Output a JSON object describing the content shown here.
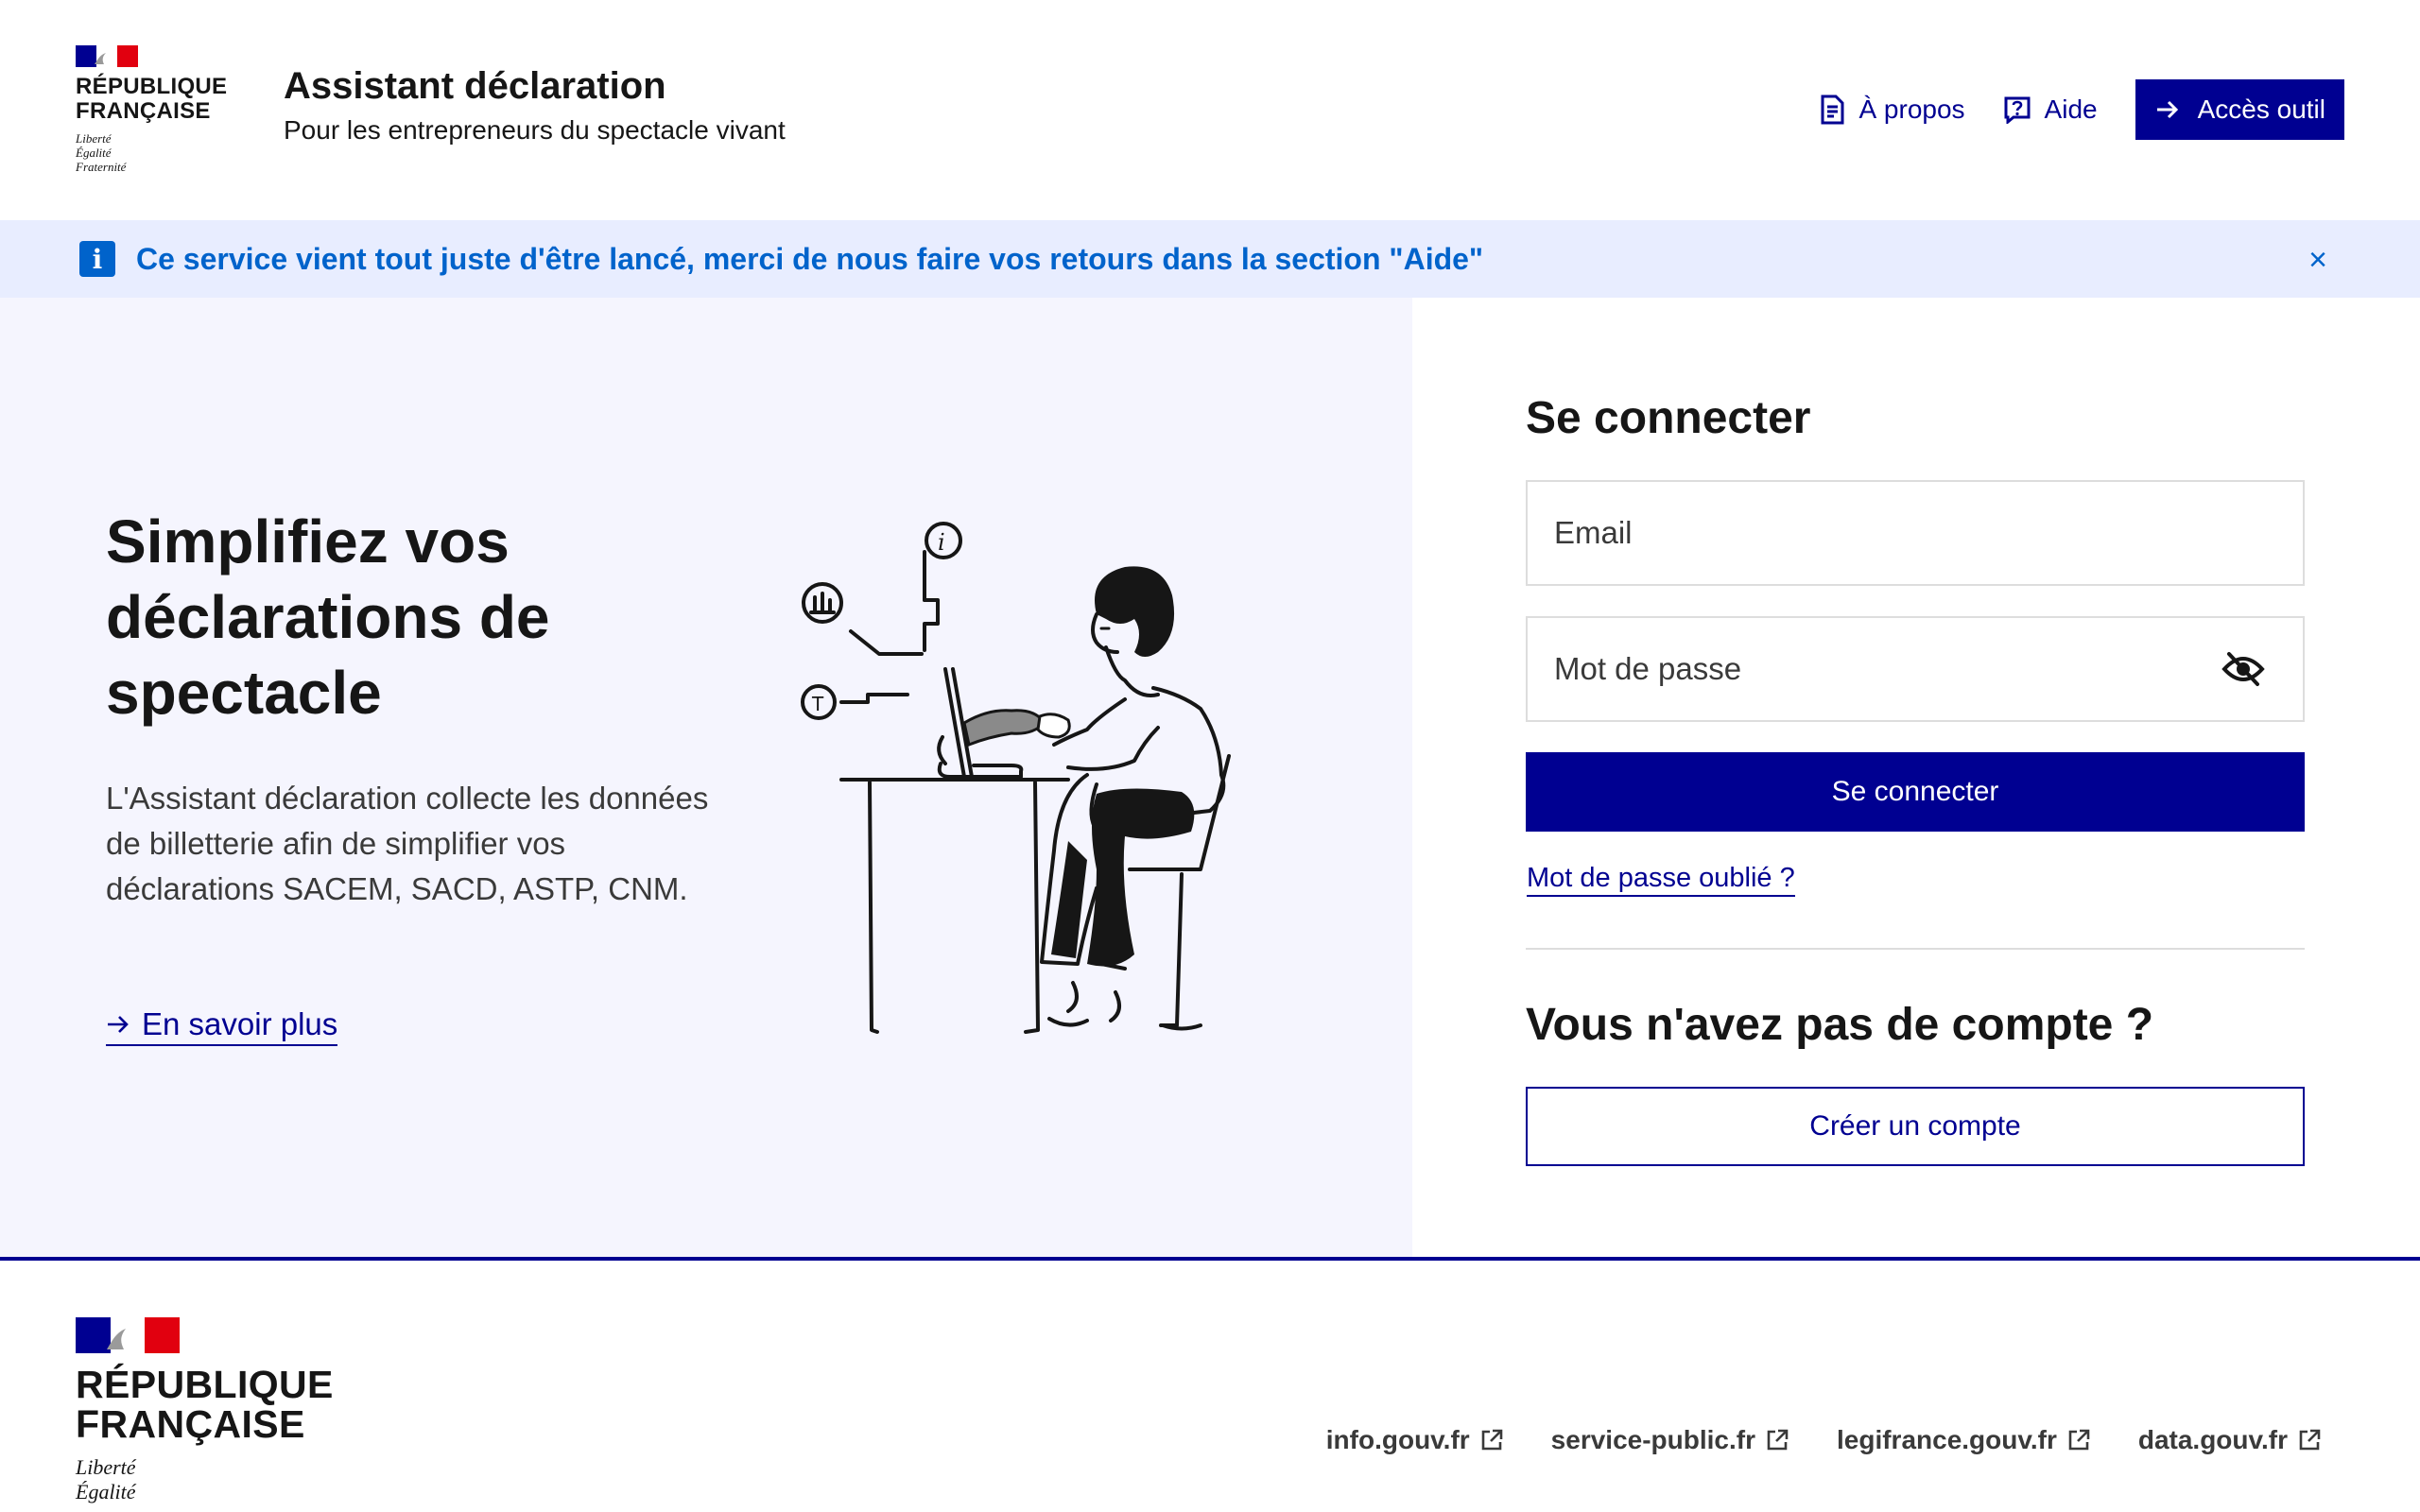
{
  "header": {
    "republic_line1": "RÉPUBLIQUE",
    "republic_line2": "FRANÇAISE",
    "motto_1": "Liberté",
    "motto_2": "Égalité",
    "motto_3": "Fraternité",
    "service_title": "Assistant déclaration",
    "service_tagline": "Pour les entrepreneurs du spectacle vivant",
    "nav": {
      "about_label": "À propos",
      "about_icon": "document-icon",
      "help_label": "Aide",
      "help_icon": "question-icon",
      "tool_label": "Accès outil",
      "tool_icon": "arrow-right-icon"
    }
  },
  "notice": {
    "text": "Ce service vient tout juste d'être lancé, merci de nous faire vos retours dans la section \"Aide\"",
    "icon": "info-icon",
    "close": "×"
  },
  "hero": {
    "title": "Simplifiez vos déclarations de spectacle",
    "description": "L'Assistant déclaration collecte les données de billetterie afin de simplifier vos déclarations SACEM, SACD, ASTP, CNM.",
    "link_label": "En savoir plus"
  },
  "login": {
    "title": "Se connecter",
    "email_placeholder": "Email",
    "password_placeholder": "Mot de passe",
    "submit_label": "Se connecter",
    "forgot_label": "Mot de passe oublié ?",
    "no_account_title": "Vous n'avez pas de compte ?",
    "create_label": "Créer un compte"
  },
  "footer": {
    "republic_line1": "RÉPUBLIQUE",
    "republic_line2": "FRANÇAISE",
    "motto_1": "Liberté",
    "motto_2": "Égalité",
    "links": [
      "info.gouv.fr",
      "service-public.fr",
      "legifrance.gouv.fr",
      "data.gouv.fr"
    ]
  },
  "colors": {
    "primary": "#000091",
    "info": "#0063cb",
    "notice_bg": "#e8edff",
    "hero_bg": "#f5f5fe",
    "marianne_red": "#e1000f"
  }
}
